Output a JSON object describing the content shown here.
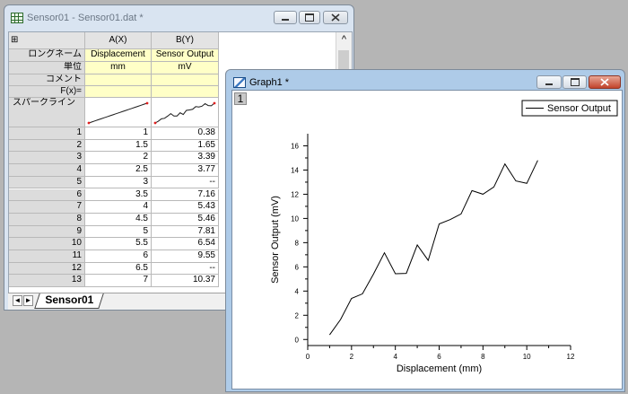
{
  "worksheet_window": {
    "title": "Sensor01 - Sensor01.dat *",
    "corner_glyph": "⊞",
    "columns": [
      {
        "name": "A(X)",
        "long_name": "Displacement",
        "unit": "mm",
        "comment": "",
        "fx": ""
      },
      {
        "name": "B(Y)",
        "long_name": "Sensor Output",
        "unit": "mV",
        "comment": "",
        "fx": ""
      }
    ],
    "row_labels": {
      "long_name": "ロングネーム",
      "unit": "単位",
      "comment": "コメント",
      "fx": "F(x)=",
      "sparkline": "スパークライン"
    },
    "rows": [
      {
        "n": "1",
        "a": "1",
        "b": "0.38"
      },
      {
        "n": "2",
        "a": "1.5",
        "b": "1.65"
      },
      {
        "n": "3",
        "a": "2",
        "b": "3.39"
      },
      {
        "n": "4",
        "a": "2.5",
        "b": "3.77"
      },
      {
        "n": "5",
        "a": "3",
        "b": "--"
      },
      {
        "n": "6",
        "a": "3.5",
        "b": "7.16"
      },
      {
        "n": "7",
        "a": "4",
        "b": "5.43"
      },
      {
        "n": "8",
        "a": "4.5",
        "b": "5.46"
      },
      {
        "n": "9",
        "a": "5",
        "b": "7.81"
      },
      {
        "n": "10",
        "a": "5.5",
        "b": "6.54"
      },
      {
        "n": "11",
        "a": "6",
        "b": "9.55"
      },
      {
        "n": "12",
        "a": "6.5",
        "b": "--"
      },
      {
        "n": "13",
        "a": "7",
        "b": "10.37"
      }
    ],
    "sheet_tab": "Sensor01",
    "scroll_up_glyph": "^",
    "tab_left_glyph": "◄",
    "tab_right_glyph": "►"
  },
  "graph_window": {
    "title": "Graph1 *",
    "layer_label": "1"
  },
  "colors": {
    "sparkline_line": "#1a1a1a",
    "sparkline_marker": "#e02020",
    "plot_line": "#000000"
  },
  "chart_data": {
    "type": "line",
    "title": "",
    "xlabel": "Displacement (mm)",
    "ylabel": "Sensor Output (mV)",
    "xlim": [
      0,
      12
    ],
    "ylim": [
      -0.5,
      17
    ],
    "xticks": [
      0,
      2,
      4,
      6,
      8,
      10,
      12
    ],
    "yticks": [
      0,
      2,
      4,
      6,
      8,
      10,
      12,
      14,
      16
    ],
    "legend_position": "top-right",
    "grid": false,
    "series": [
      {
        "name": "Sensor Output",
        "x": [
          1,
          1.5,
          2,
          2.5,
          3,
          3.5,
          4,
          4.5,
          5,
          5.5,
          6,
          6.5,
          7,
          7.5,
          8,
          8.5,
          9,
          9.5,
          10,
          10.5
        ],
        "y": [
          0.38,
          1.65,
          3.39,
          3.77,
          5.4,
          7.16,
          5.43,
          5.46,
          7.81,
          6.54,
          9.55,
          9.9,
          10.37,
          12.3,
          12.0,
          12.6,
          14.5,
          13.1,
          12.9,
          14.8
        ]
      }
    ]
  }
}
